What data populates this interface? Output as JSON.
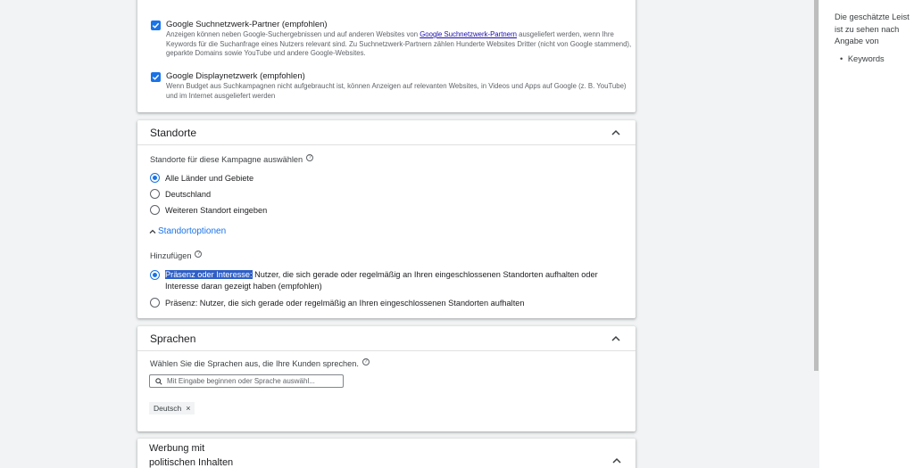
{
  "network": {
    "search_partners": {
      "title": "Google Suchnetzwerk-Partner (empfohlen)",
      "desc_before": "Anzeigen können neben Google-Suchergebnissen und auf anderen Websites von ",
      "desc_link": "Google Suchnetzwerk-Partnern",
      "desc_after": " ausgeliefert werden, wenn Ihre Keywords für die Suchanfrage eines Nutzers relevant sind. Zu Suchnetzwerk-Partnern zählen Hunderte Websites Dritter (nicht von Google stammend), geparkte Domains sowie YouTube und andere Google-Websites."
    },
    "display": {
      "title": "Google Displaynetzwerk (empfohlen)",
      "desc": "Wenn Budget aus Suchkampagnen nicht aufgebraucht ist, können Anzeigen auf relevanten Websites, in Videos und Apps auf Google (z. B. YouTube) und im Internet ausgeliefert werden"
    }
  },
  "locations": {
    "title": "Standorte",
    "prompt": "Standorte für diese Kampagne auswählen",
    "options": [
      "Alle Länder und Gebiete",
      "Deutschland",
      "Weiteren Standort eingeben"
    ],
    "options_toggle": "Standortoptionen",
    "include_label": "Hinzufügen",
    "presence_interest_highlight": "Präsenz oder Interesse:",
    "presence_interest_rest": " Nutzer, die sich gerade oder regelmäßig an Ihren eingeschlossenen Standorten aufhalten oder Interesse daran gezeigt haben (empfohlen)",
    "presence_only": "Präsenz: Nutzer, die sich gerade oder regelmäßig an Ihren eingeschlossenen Standorten aufhalten"
  },
  "languages": {
    "title": "Sprachen",
    "prompt": "Wählen Sie die Sprachen aus, die Ihre Kunden sprechen.",
    "search_placeholder": "Mit Eingabe beginnen oder Sprache auswähl...",
    "chip": "Deutsch"
  },
  "political": {
    "title_line1": "Werbung mit",
    "title_line2": "politischen Inhalten"
  },
  "side": {
    "text": "Die geschätzte Leist ist zu sehen nach Angabe von",
    "bullet": "Keywords"
  },
  "colors": {
    "accent": "#1a73e8",
    "highlight": "#2f5fc7"
  }
}
